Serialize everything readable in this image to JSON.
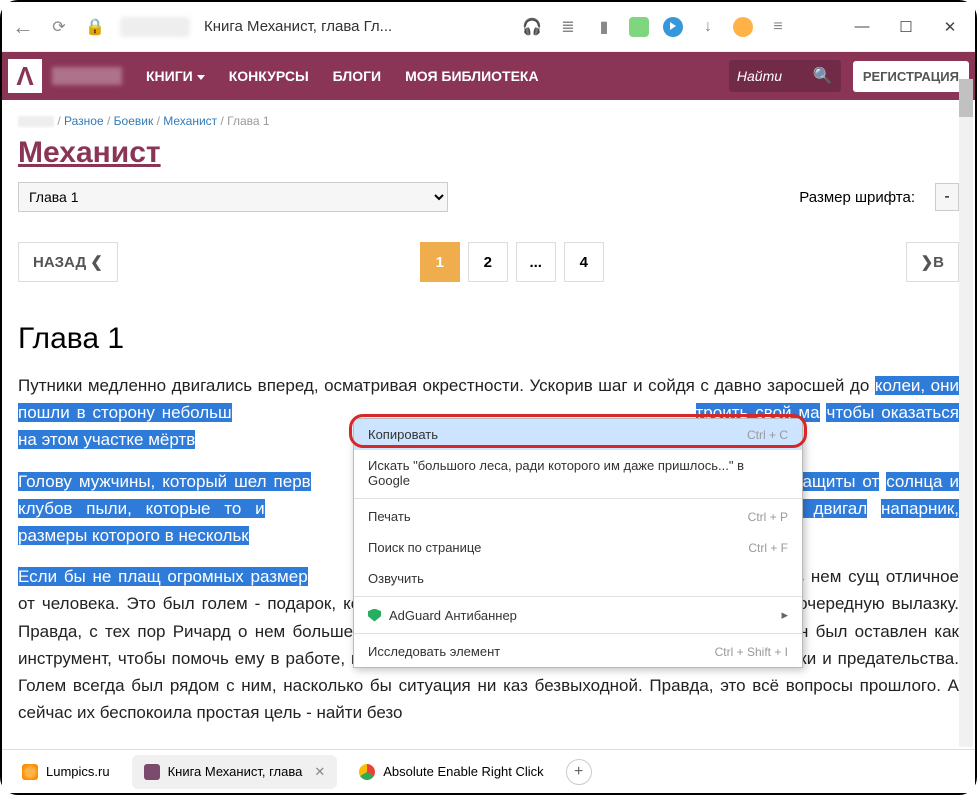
{
  "chrome": {
    "title": "Книга Механист, глава Гл..."
  },
  "window": {
    "min": "—",
    "max": "☐",
    "close": "✕"
  },
  "nav": {
    "books": "КНИГИ",
    "contests": "КОНКУРСЫ",
    "blogs": "БЛОГИ",
    "library": "МОЯ БИБЛИОТЕКА",
    "search_ph": "Найти",
    "register": "РЕГИСТРАЦИЯ"
  },
  "crumbs": {
    "misc": "Разное",
    "action": "Боевик",
    "book": "Механист",
    "chapter": "Глава 1",
    "sep": " / "
  },
  "title": "Механист",
  "chapter_sel": "Глава 1",
  "font_label": "Размер шрифта:",
  "font_minus": "-",
  "pager": {
    "back": "НАЗАД",
    "p1": "1",
    "p2": "2",
    "dots": "...",
    "p4": "4",
    "fwd": "В"
  },
  "chapter_heading": "Глава 1",
  "p1a": "Путники медленно двигались вперед, осматривая окрестности.  Ускорив шаг и сойдя с давно заросшей до",
  "p1b": "колеи, они пошли в сторону небольш",
  "p1c": "троить свой ма",
  "p1d": "чтобы оказаться на этом участке мёртв",
  "p2a": "Голову мужчины, который шел перв",
  "p2b": "для защиты от",
  "p2c": "солнца и клубов пыли, которые то и",
  "p2d": "м за ним двигал",
  "p2e": "напарник, размеры которого в нескольк",
  "p3a": "Если бы не плащ огромных размер",
  "p3b": " бы в нем сущ",
  "p3c": "отличное от человека. Это был голем - подарок, который ему достался от наставника, когда тот отправ",
  "p3d": "очередную вылазку. Правда, с тех пор Ричард о нем больше ничего не слышал. А его подарок служит ему",
  "p3e": "день.Он был оставлен как инструмент, чтобы помочь ему в работе, который впоследствии стал его другом",
  "p3f": "мире, полном лжи и предательства. Голем всегда был рядом с ним, насколько бы ситуация ни каз",
  "p3g": "безвыходной. Правда, это всё вопросы прошлого. А сейчас их беспокоила простая цель - найти безо",
  "ctx": {
    "copy": "Копировать",
    "copy_sc": "Ctrl + C",
    "search": "Искать \"большого леса, ради которого им даже пришлось...\" в Google",
    "print": "Печать",
    "print_sc": "Ctrl + P",
    "find": "Поиск по странице",
    "find_sc": "Ctrl + F",
    "speak": "Озвучить",
    "adguard": "AdGuard Антибаннер",
    "inspect": "Исследовать элемент",
    "inspect_sc": "Ctrl + Shift + I"
  },
  "tabs": {
    "t1": "Lumpics.ru",
    "t2": "Книга Механист, глава",
    "t3": "Absolute Enable Right Click"
  }
}
